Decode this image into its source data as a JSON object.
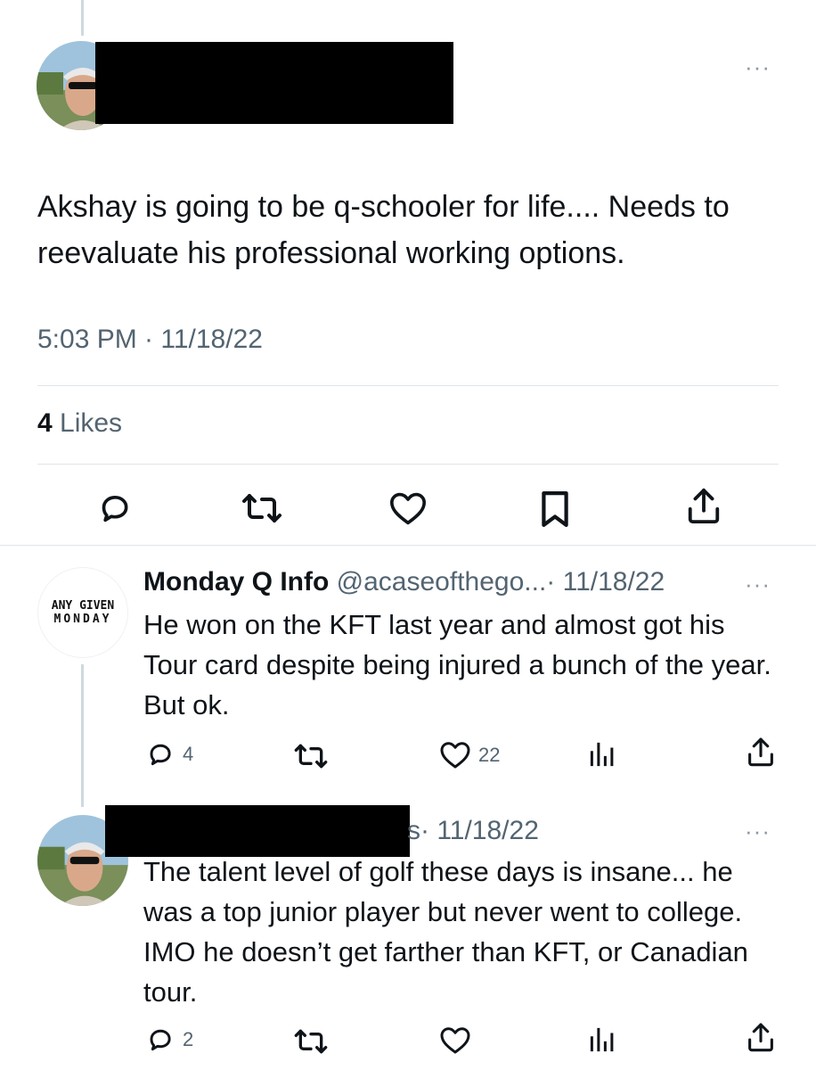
{
  "main_tweet": {
    "text": "Akshay is going to be q-schooler for life.... Needs to reevaluate his professional working options.",
    "timestamp": "5:03 PM · 11/18/22",
    "likes_count": "4",
    "likes_label": " Likes",
    "more_label": "···"
  },
  "replies": [
    {
      "name": "Monday Q Info",
      "handle": "@acaseofthego...",
      "date": "· 11/18/22",
      "avatar_line1": "ANY GIVEN",
      "avatar_line2": "MONDAY",
      "text": "He won on the KFT last year and almost got his Tour card despite being injured a bunch of the year.  But ok.",
      "reply_count": "4",
      "like_count": "22",
      "more_label": "···"
    },
    {
      "name_partial": "s",
      "date": "· 11/18/22",
      "text": "The talent level of golf these days is insane... he was a top junior player but never went to college. IMO he doesn’t get farther than KFT, or Canadian tour.",
      "reply_count": "2",
      "more_label": "···"
    }
  ]
}
